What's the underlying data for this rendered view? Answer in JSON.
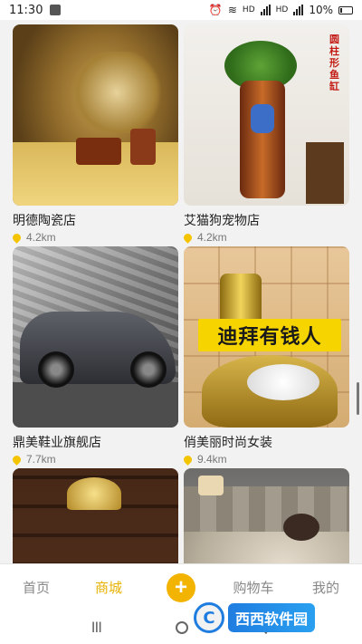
{
  "status_bar": {
    "time": "11:30",
    "battery": "10%",
    "net_label_1": "HD",
    "net_label_2": "HD"
  },
  "shops": [
    {
      "name": "明德陶瓷店",
      "distance": "4.2km",
      "image": "ceramic-hall-image"
    },
    {
      "name": "艾猫狗宠物店",
      "distance": "4.2km",
      "image": "vase-aquarium-image",
      "image_text": "圆柱形鱼缸"
    },
    {
      "name": "鼎美鞋业旗舰店",
      "distance": "7.7km",
      "image": "sports-car-image"
    },
    {
      "name": "俏美丽时尚女装",
      "distance": "9.4km",
      "image": "gold-toilet-image",
      "image_banner": "迪拜有钱人"
    },
    {
      "name": "",
      "distance": "",
      "image": "wooden-shelf-image"
    },
    {
      "name": "",
      "distance": "",
      "image": "bedroom-image"
    }
  ],
  "tabbar": {
    "home": "首页",
    "mall": "商城",
    "add": "+",
    "cart": "购物车",
    "mine": "我的",
    "active_color": "#e7b200"
  },
  "navbar": {
    "recent": "III"
  },
  "watermark": {
    "text": "西西软件园"
  }
}
